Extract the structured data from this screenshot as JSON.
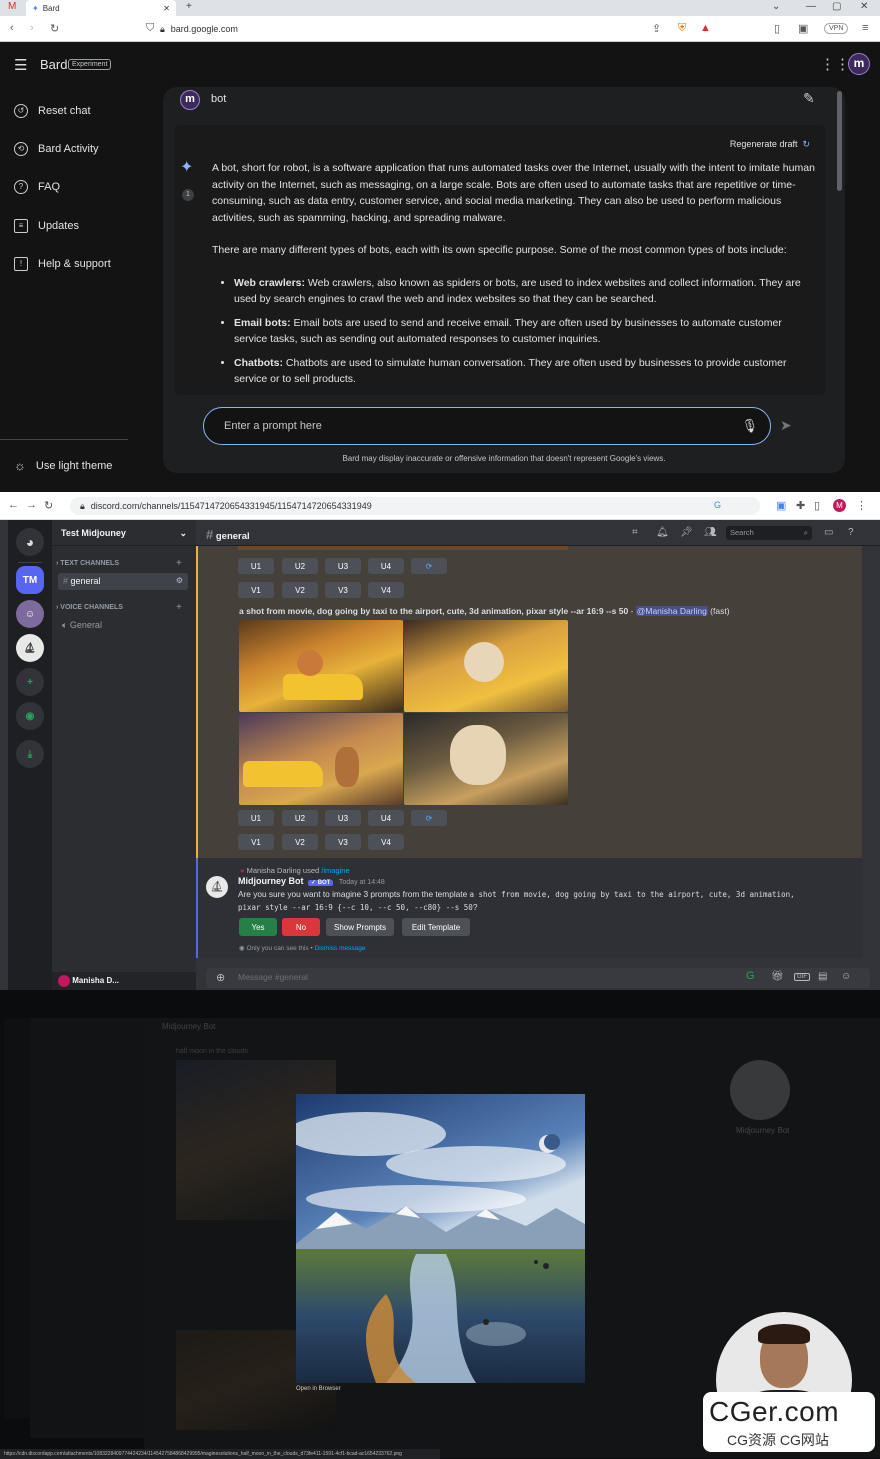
{
  "bard_browser": {
    "tab_title": "Bard",
    "url": "bard.google.com",
    "vpn_label": "VPN"
  },
  "bard": {
    "app_name": "Bard",
    "badge": "Experiment",
    "sidebar": [
      {
        "label": "Reset chat",
        "icon": "reset-icon"
      },
      {
        "label": "Bard Activity",
        "icon": "history-icon"
      },
      {
        "label": "FAQ",
        "icon": "help-icon"
      },
      {
        "label": "Updates",
        "icon": "updates-icon"
      },
      {
        "label": "Help & support",
        "icon": "feedback-icon"
      }
    ],
    "theme_toggle": "Use light theme",
    "user_query": "bot",
    "regenerate": "Regenerate draft",
    "draft_number": "1",
    "response": {
      "p1": "A bot, short for robot, is a software application that runs automated tasks over the Internet, usually with the intent to imitate human activity on the Internet, such as messaging, on a large scale. Bots are often used to automate tasks that are repetitive or time-consuming, such as data entry, customer service, and social media marketing. They can also be used to perform malicious activities, such as spamming, hacking, and spreading malware.",
      "p2": "There are many different types of bots, each with its own specific purpose. Some of the most common types of bots include:",
      "bullets": [
        {
          "term": "Web crawlers:",
          "text": " Web crawlers, also known as spiders or bots, are used to index websites and collect information. They are used by search engines to crawl the web and index websites so that they can be searched."
        },
        {
          "term": "Email bots:",
          "text": " Email bots are used to send and receive email. They are often used by businesses to automate customer service tasks, such as sending out automated responses to customer inquiries."
        },
        {
          "term": "Chatbots:",
          "text": " Chatbots are used to simulate human conversation. They are often used by businesses to provide customer service or to sell products."
        }
      ]
    },
    "prompt_placeholder": "Enter a prompt here",
    "disclaimer": "Bard may display inaccurate or offensive information that doesn't represent Google's views."
  },
  "discord_browser": {
    "url": "discord.com/channels/1154714720654331945/1154714720654331949"
  },
  "discord": {
    "server_name": "Test Midjouney",
    "server_initials": "TM",
    "text_channels_header": "TEXT CHANNELS",
    "channel_general": "general",
    "voice_channels_header": "VOICE CHANNELS",
    "voice_general": "General",
    "channel_title": "general",
    "search_placeholder": "Search",
    "upscale_buttons": [
      "U1",
      "U2",
      "U3",
      "U4"
    ],
    "variation_buttons": [
      "V1",
      "V2",
      "V3",
      "V4"
    ],
    "job_prompt": "a shot from movie, dog going by taxi to the airport, cute, 3d animation, pixar style --ar 16:9 --s 50",
    "job_mention": "@Manisha Darling",
    "job_speed": "(fast)",
    "reply_user": "Manisha Darling used",
    "reply_command": "/imagine",
    "bot_name": "Midjourney Bot",
    "bot_badge": "✓ BOT",
    "bot_time": "Today at 14:48",
    "bot_msg_lead": "Are you sure you want to imagine 3 prompts from the template",
    "bot_msg_code": "a shot from movie, dog going by taxi to the airport, cute, 3d animation, pixar style --ar 16:9 {--c 10, --c 50, --c80}  --s 50",
    "bot_msg_tail": "?",
    "btn_yes": "Yes",
    "btn_no": "No",
    "btn_show": "Show Prompts",
    "btn_edit": "Edit Template",
    "ephemeral_note": "Only you can see this •",
    "dismiss": "Dismiss message",
    "message_placeholder": "Message #general",
    "user_panel_name": "Manisha D...",
    "toolbar_gif": "GIF"
  },
  "viewer": {
    "open_browser": "Open in Browser",
    "status_url": "https://cdn.discordapp.com/attachments/1083228409774424234/1145427584868429995/maginesolutions_half_moon_in_the_clouds_d73fe411-1591-4cf1-bcad-ac1654233762.png",
    "bg_channel": "Midjourney Bot",
    "bg_snippet": "half moon in the clouds",
    "bg_profile_name": "Midjourney Bot"
  },
  "watermark": {
    "main": "CGer.com",
    "sub": "CG资源 CG网站"
  }
}
